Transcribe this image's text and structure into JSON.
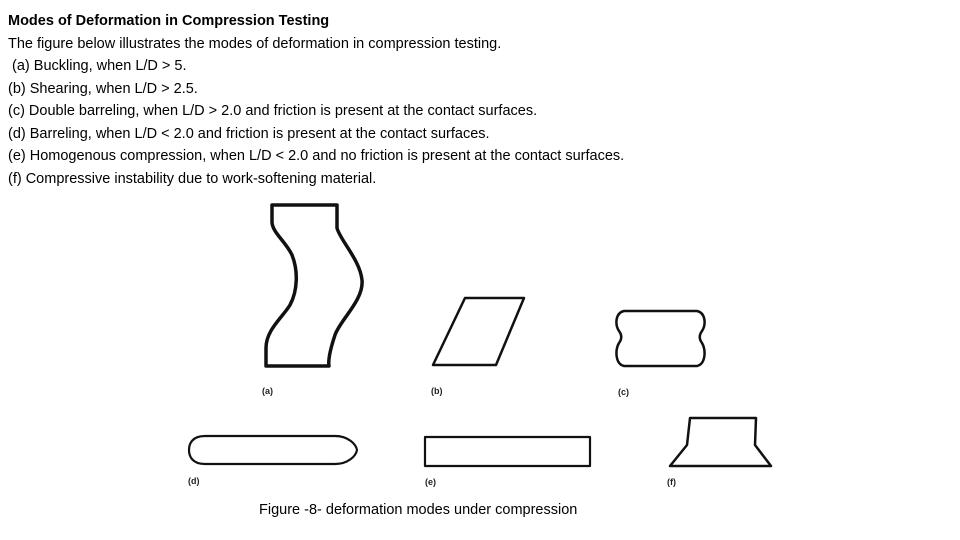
{
  "document": {
    "title": "Modes of Deformation in Compression Testing",
    "intro": "The figure below illustrates the modes of deformation in compression testing.",
    "items": [
      " (a) Buckling, when L/D > 5.",
      "(b) Shearing, when L/D > 2.5.",
      "(c) Double barreling, when L/D > 2.0 and friction is present at the contact surfaces.",
      "(d) Barreling, when L/D < 2.0 and friction is present at the contact surfaces.",
      "(e) Homogenous compression, when L/D < 2.0 and no friction is present at the contact surfaces.",
      "(f) Compressive instability due to work-softening material."
    ]
  },
  "figure": {
    "labels": {
      "a": "(a)",
      "b": "(b)",
      "c": "(c)",
      "d": "(d)",
      "e": "(e)",
      "f": "(f)"
    },
    "caption": "Figure -8- deformation modes under compression"
  }
}
